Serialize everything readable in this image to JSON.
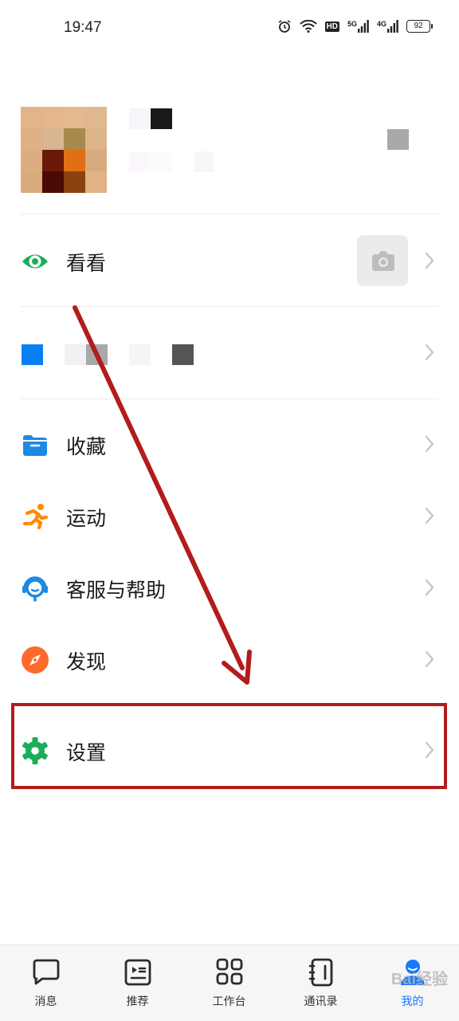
{
  "status_bar": {
    "time": "19:47",
    "net_5g": "5G",
    "net_4g": "4G",
    "hd": "HD",
    "battery": "92"
  },
  "menu": {
    "kankan": "看看",
    "favorites": "收藏",
    "sports": "运动",
    "support": "客服与帮助",
    "discover": "发现",
    "settings": "设置"
  },
  "tabs": [
    {
      "label": "消息"
    },
    {
      "label": "推荐"
    },
    {
      "label": "工作台"
    },
    {
      "label": "通讯录"
    },
    {
      "label": "我的"
    }
  ],
  "watermark": "Bai经验",
  "colors": {
    "accent": "#1677ff",
    "annotation": "#b21c1c",
    "kankan_icon": "#1aad5a",
    "favorites_icon": "#1e88e5",
    "sports_icon": "#ff8a00",
    "discover_icon": "#ff6a2b",
    "settings_icon": "#1aad5a"
  }
}
